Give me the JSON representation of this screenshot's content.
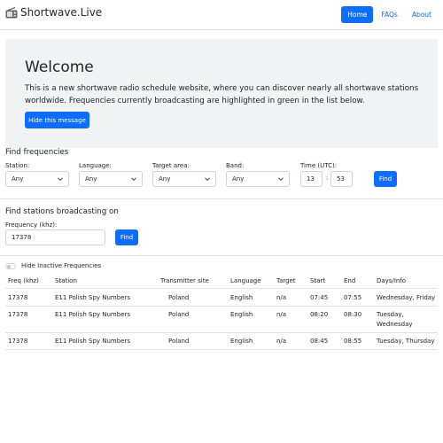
{
  "navbar": {
    "brand": "Shortwave.Live",
    "brand_icon": "radio-icon",
    "links": [
      "Home",
      "FAQs",
      "About"
    ]
  },
  "welcome": {
    "title": "Welcome",
    "text": "This is a new shortwave radio schedule website, where you can discover nearly all shortwave stations worldwide. Frequencies currently broadcasting are highlighted in green in the list below.",
    "hide_button": "Hide this message"
  },
  "find_frequencies": {
    "title": "Find frequencies",
    "station_label": "Station:",
    "station_value": "Any",
    "language_label": "Language:",
    "language_value": "Any",
    "target_label": "Target area:",
    "target_value": "Any",
    "band_label": "Band:",
    "band_value": "Any",
    "time_label": "Time (UTC):",
    "hour": "13",
    "separator": ":",
    "minute": "53",
    "find_button": "Find"
  },
  "find_stations": {
    "title": "Find stations broadcasting on",
    "frequency_label": "Frequency (khz):",
    "frequency_value": "17378",
    "find_button": "Find"
  },
  "toggle": {
    "label": "Hide Inactive Frequencies"
  },
  "table": {
    "headers": [
      "Freq (khz)",
      "Station",
      "Transmitter site",
      "Language",
      "Target",
      "Start",
      "End",
      "Days/Info"
    ],
    "rows": [
      [
        "17378",
        "E11 Polish Spy Numbers",
        "Poland",
        "English",
        "n/a",
        "07:45",
        "07:55",
        "Wednesday, Friday"
      ],
      [
        "17378",
        "E11 Polish Spy Numbers",
        "Poland",
        "English",
        "n/a",
        "08:20",
        "08:30",
        "Tuesday, Wednesday"
      ],
      [
        "17378",
        "E11 Polish Spy Numbers",
        "Poland",
        "English",
        "n/a",
        "08:45",
        "08:55",
        "Tuesday, Thursday"
      ]
    ]
  },
  "colors": {
    "accent": "#0d6efd",
    "banner_bg": "#f1f3f5",
    "border": "#dee2e6"
  }
}
